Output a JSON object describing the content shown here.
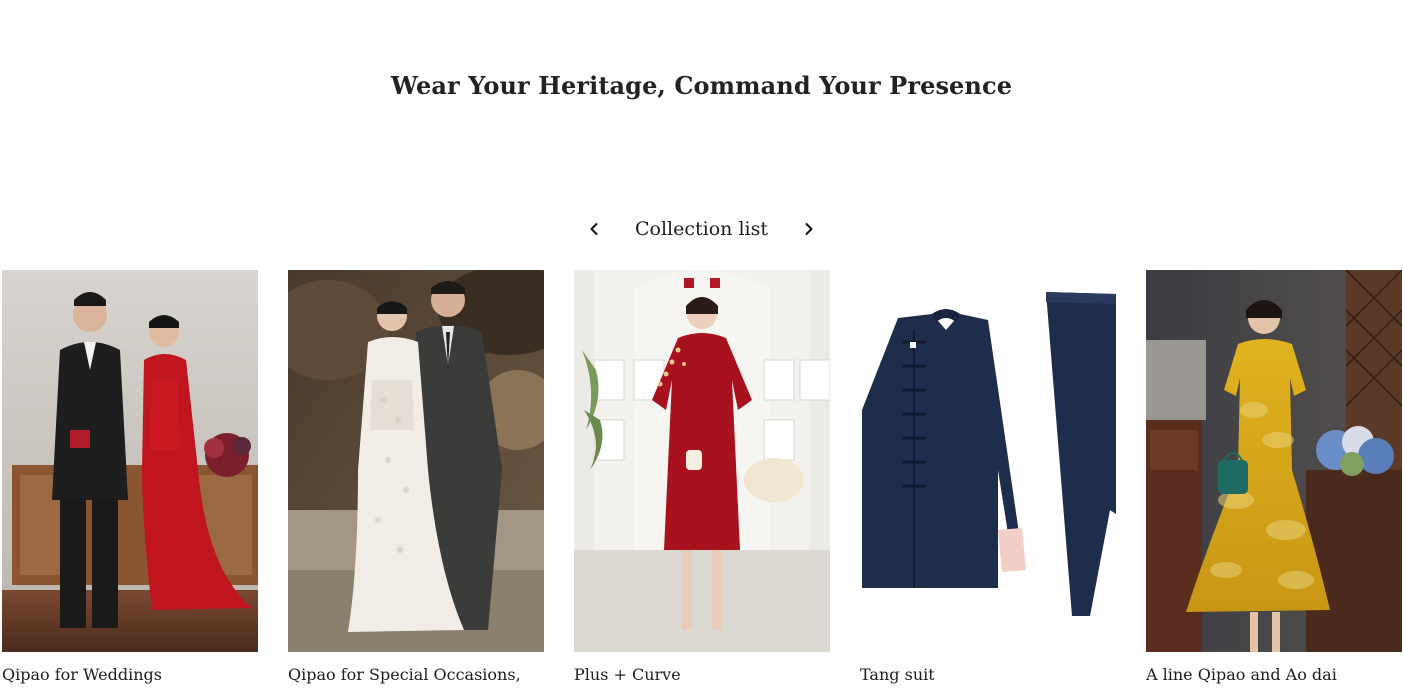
{
  "headline": "Wear Your Heritage, Command Your Presence",
  "collection_nav": {
    "title": "Collection list",
    "prev_icon": "chevron-left-icon",
    "next_icon": "chevron-right-icon"
  },
  "collections": [
    {
      "label": "Qipao for Weddings"
    },
    {
      "label": "Qipao for Special Occasions,"
    },
    {
      "label": "Plus + Curve"
    },
    {
      "label": "Tang suit"
    },
    {
      "label": "A line Qipao and Ao dai"
    }
  ],
  "colors": {
    "text": "#1d1d1d",
    "background": "#ffffff"
  }
}
